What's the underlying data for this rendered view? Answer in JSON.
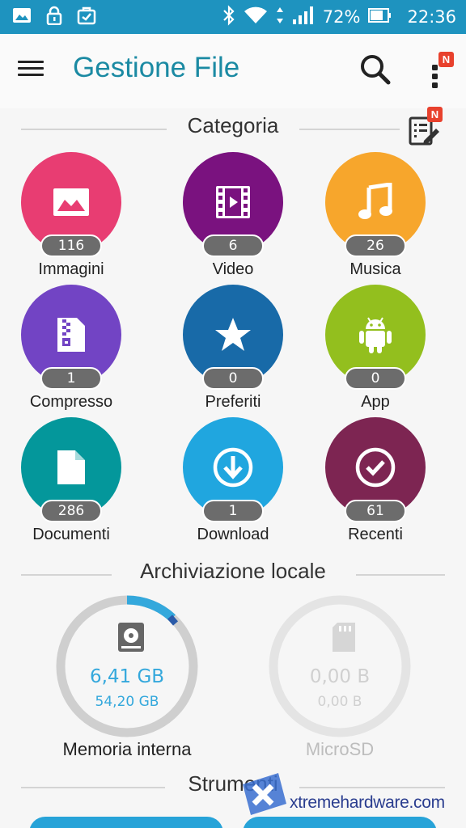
{
  "status_bar": {
    "battery_percent": "72%",
    "time": "22:36"
  },
  "app_bar": {
    "title": "Gestione File",
    "overflow_badge": "N"
  },
  "category_section": {
    "title": "Categoria",
    "edit_badge": "N",
    "items": [
      {
        "label": "Immagini",
        "count": "116",
        "color": "#e83d72",
        "icon": "image-icon"
      },
      {
        "label": "Video",
        "count": "6",
        "color": "#7a127f",
        "icon": "film-icon"
      },
      {
        "label": "Musica",
        "count": "26",
        "color": "#f7a62c",
        "icon": "music-note-icon"
      },
      {
        "label": "Compresso",
        "count": "1",
        "color": "#7244c4",
        "icon": "zip-file-icon"
      },
      {
        "label": "Preferiti",
        "count": "0",
        "color": "#186aa8",
        "icon": "star-icon"
      },
      {
        "label": "App",
        "count": "0",
        "color": "#93bf1e",
        "icon": "android-icon"
      },
      {
        "label": "Documenti",
        "count": "286",
        "color": "#04979b",
        "icon": "document-icon"
      },
      {
        "label": "Download",
        "count": "1",
        "color": "#20a6df",
        "icon": "download-icon"
      },
      {
        "label": "Recenti",
        "count": "61",
        "color": "#7d2552",
        "icon": "check-circle-icon"
      }
    ]
  },
  "storage_section": {
    "title": "Archiviazione locale",
    "internal": {
      "label": "Memoria interna",
      "used": "6,41 GB",
      "total": "54,20 GB",
      "used_fraction": 0.12,
      "accent": "#34a8dc",
      "icon": "hard-drive-icon"
    },
    "sd": {
      "label": "MicroSD",
      "used": "0,00 B",
      "total": "0,00 B",
      "icon": "sd-card-icon"
    }
  },
  "tools_section": {
    "title": "Strumenti"
  },
  "watermark": {
    "text": "xtremehardware.com"
  }
}
